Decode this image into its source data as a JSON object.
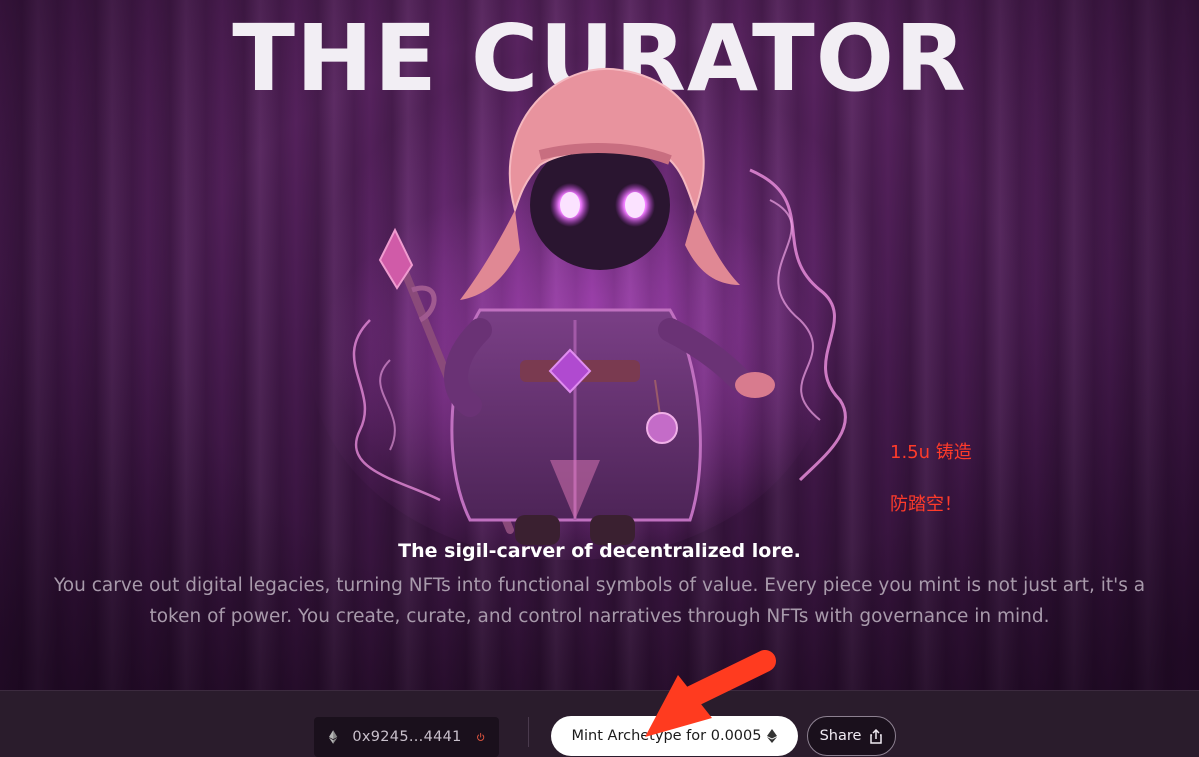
{
  "header": {
    "title": "THE CURATOR"
  },
  "annotations": {
    "line1": "1.5u 铸造",
    "line2": "防踏空！"
  },
  "content": {
    "tagline": "The sigil-carver of decentralized lore.",
    "description": "You carve out digital legacies, turning NFTs into functional symbols of value. Every piece you mint is not just art, it's a token of power. You create, curate, and control narratives through NFTs with governance in mind."
  },
  "wallet": {
    "address": "0x9245...4441",
    "icon": "ethereum-icon",
    "disconnect_icon": "power-icon"
  },
  "actions": {
    "mint_label": "Mint Archetype for 0.0005",
    "mint_icon": "ethereum-icon",
    "share_label": "Share",
    "share_icon": "share-icon"
  },
  "colors": {
    "accent_annotation": "#ff3b2a",
    "background": "#4a1c52",
    "bottom_bar": "#2a1c2c",
    "mint_button": "#ffffff"
  }
}
